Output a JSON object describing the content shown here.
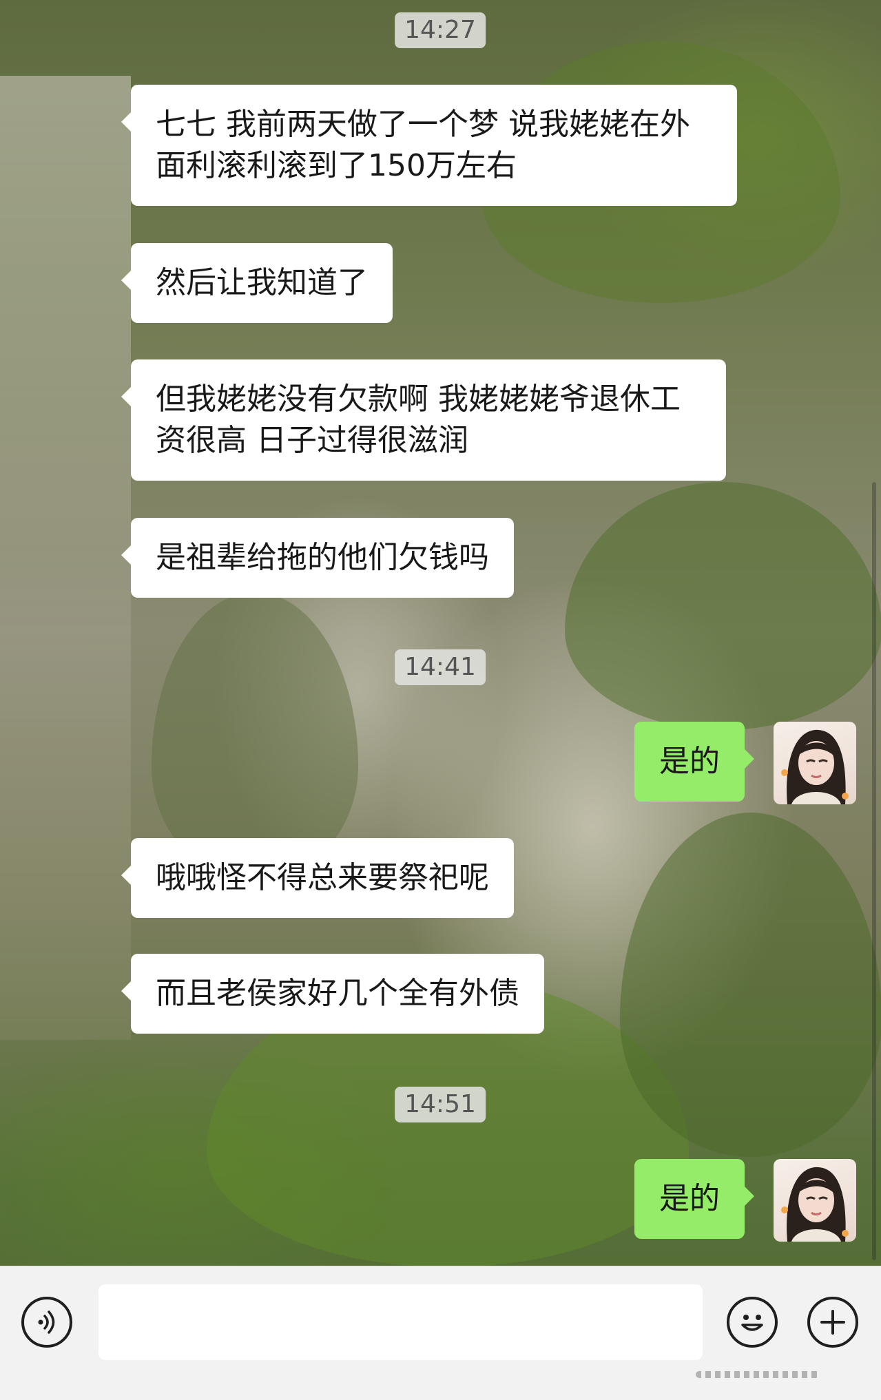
{
  "timestamps": [
    "14:27",
    "14:41",
    "14:51"
  ],
  "messages": [
    {
      "side": "left",
      "text": "七七 我前两天做了一个梦 说我姥姥在外面利滚利滚到了150万左右"
    },
    {
      "side": "left",
      "text": "然后让我知道了"
    },
    {
      "side": "left",
      "text": "但我姥姥没有欠款啊 我姥姥姥爷退休工资很高 日子过得很滋润"
    },
    {
      "side": "left",
      "text": "是祖辈给拖的他们欠钱吗"
    },
    {
      "side": "right",
      "text": "是的"
    },
    {
      "side": "left",
      "text": "哦哦怪不得总来要祭祀呢"
    },
    {
      "side": "left",
      "text": "而且老侯家好几个全有外债"
    },
    {
      "side": "right",
      "text": "是的"
    }
  ],
  "input": {
    "value": "",
    "placeholder": ""
  },
  "icons": {
    "voice": "voice-icon",
    "emoji": "emoji-icon",
    "more": "plus-icon"
  },
  "colors": {
    "sent_bubble": "#95ec69",
    "received_bubble": "#ffffff",
    "input_bar": "#f2f2f2"
  }
}
